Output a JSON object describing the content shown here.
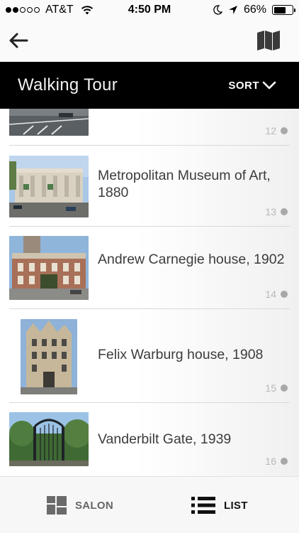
{
  "status_bar": {
    "carrier": "AT&T",
    "time": "4:50 PM",
    "battery_percent": "66%",
    "battery_level": 0.66,
    "signal_bars_filled": 2,
    "signal_bars_total": 5,
    "icons": [
      "wifi-icon",
      "moon-icon",
      "location-arrow-icon",
      "battery-icon"
    ]
  },
  "nav": {
    "back_icon": "arrow-left-icon",
    "map_icon": "folded-map-icon"
  },
  "header": {
    "title": "Walking Tour",
    "sort_label": "SORT",
    "sort_icon": "chevron-down-icon"
  },
  "list": {
    "items": [
      {
        "title": "",
        "number": "12",
        "image": "street-crosswalk-photo"
      },
      {
        "title": "Metropolitan Museum of Art, 1880",
        "number": "13",
        "image": "metropolitan-museum-photo"
      },
      {
        "title": "Andrew Carnegie house, 1902",
        "number": "14",
        "image": "carnegie-house-photo"
      },
      {
        "title": "Felix Warburg house, 1908",
        "number": "15",
        "image": "warburg-house-photo"
      },
      {
        "title": "Vanderbilt Gate, 1939",
        "number": "16",
        "image": "vanderbilt-gate-photo"
      }
    ]
  },
  "tab_bar": {
    "salon_label": "SALON",
    "salon_icon": "grid-tiles-icon",
    "list_label": "LIST",
    "list_icon": "list-icon",
    "active_tab": "LIST"
  },
  "colors": {
    "header_bg": "#000000",
    "header_text": "#ffffff",
    "title_text": "#3c3c3c",
    "number_text": "#b8b8b8",
    "tab_bar_bg": "#f7f7f7"
  }
}
